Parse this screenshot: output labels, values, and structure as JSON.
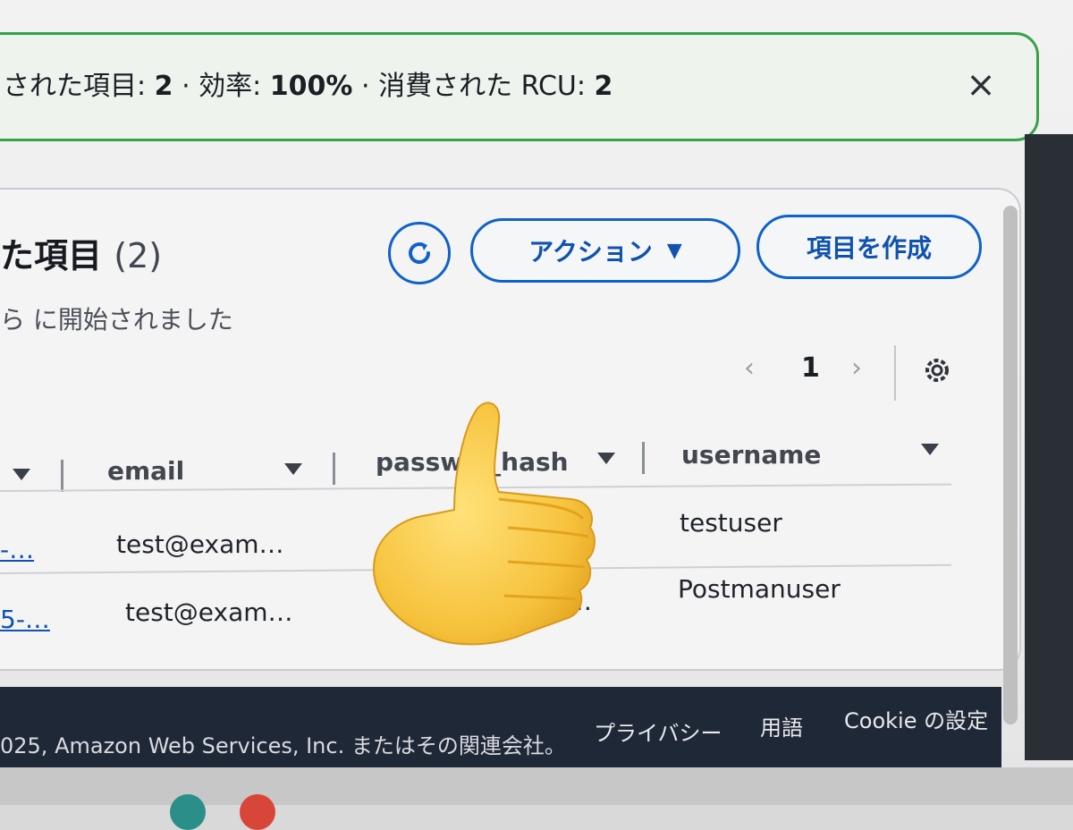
{
  "banner": {
    "text_prefix": "された項目: ",
    "returned": "2",
    "sep1": " · 効率: ",
    "efficiency": "100%",
    "sep2": " · 消費された RCU: ",
    "rcu": "2",
    "close_symbol": "×"
  },
  "panel": {
    "title": "た項目",
    "count": "(2)",
    "subtitle": "ら に開始されました"
  },
  "toolbar": {
    "actions_label": "アクション",
    "actions_caret": "▼",
    "create_label": "項目を作成"
  },
  "pagination": {
    "prev": "‹",
    "page": "1",
    "next": "›"
  },
  "table": {
    "columns": [
      "email",
      "passw…_hash",
      "username"
    ],
    "rows": [
      {
        "id": "-…",
        "email": "test@exam…",
        "password_hash": "",
        "username": "testuser"
      },
      {
        "id": "5-…",
        "email": "test@exam…",
        "password_hash": "…",
        "username": "Postmanuser"
      }
    ]
  },
  "footer": {
    "copyright": "025, Amazon Web Services, Inc. またはその関連会社。",
    "links": [
      "プライバシー",
      "用語",
      "Cookie の設定"
    ]
  },
  "colors": {
    "accent": "#0f62c9",
    "success_border": "#37a24a",
    "footer_bg": "#1f2836"
  },
  "icons": [
    "refresh-icon",
    "close-icon",
    "settings-gear-icon",
    "caret-down-icon",
    "thumbs-up-emoji"
  ]
}
